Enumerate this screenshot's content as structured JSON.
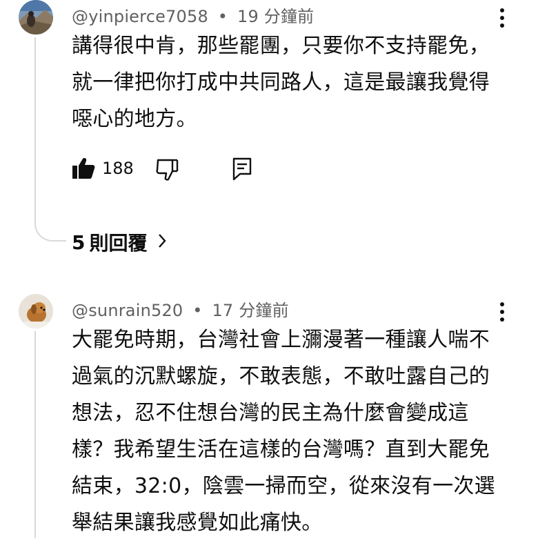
{
  "comments": [
    {
      "username": "@yinpierce7058",
      "time": "19 分鐘前",
      "lines": [
        "講得很中肯，那些罷團，只要你不支持罷免，",
        "就一律把你打成中共同路人，這是最讓我覺得",
        "噁心的地方。"
      ],
      "likes": "188",
      "avatar_icon": "mountain-photo-avatar"
    },
    {
      "username": "@sunrain520",
      "time": "17 分鐘前",
      "lines": [
        "大罷免時期，台灣社會上瀰漫著一種讓人喘不",
        "過氣的沉默螺旋，不敢表態，不敢吐露自己的",
        "想法，忍不住想台灣的民主為什麼會變成這",
        "樣？我希望生活在這樣的台灣嗎？直到大罷免",
        "結束，32:0，陰雲一掃而空，從來沒有一次選",
        "舉結果讓我感覺如此痛快。"
      ],
      "avatar_icon": "dog-photo-avatar"
    }
  ],
  "replies": {
    "count": "5",
    "label": "則回覆"
  },
  "separator": "•",
  "icons": {
    "like": "thumbs-up-filled-icon",
    "dislike": "thumbs-down-outline-icon",
    "reply": "reply-comment-icon",
    "more": "more-vertical-icon",
    "chevron": "chevron-right-icon"
  }
}
